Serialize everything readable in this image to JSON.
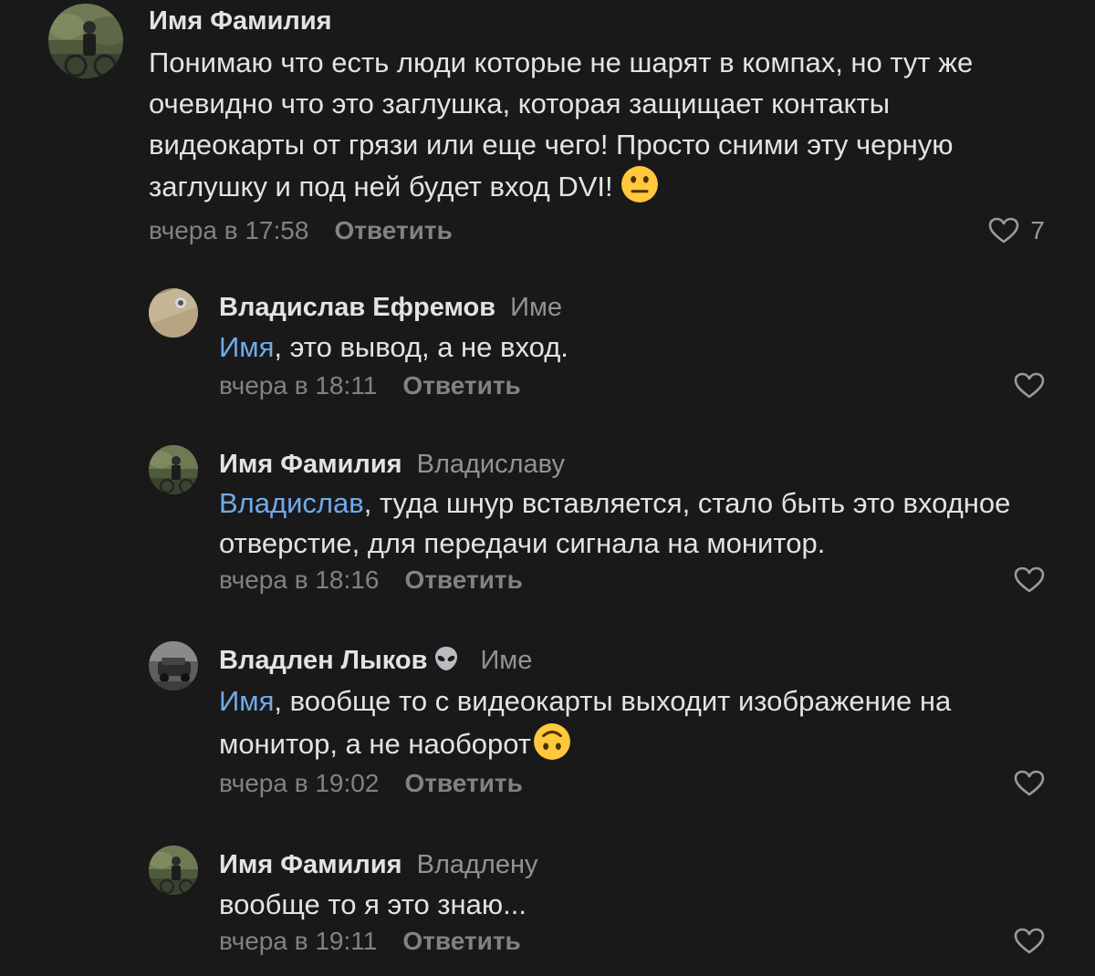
{
  "comments": [
    {
      "author": "Имя Фамилия",
      "reply_to": "",
      "mention": "",
      "text": "Понимаю что есть люди которые не шарят в компах, но тут же очевидно что это заглушка, которая защищает контакты видеокарты от грязи или еще чего! Просто сними эту  черную заглушку и под ней будет вход DVI!",
      "emoji": "neutral-face",
      "time": "вчера в 17:58",
      "reply_label": "Ответить",
      "likes": "7"
    },
    {
      "author": "Владислав Ефремов",
      "reply_to": "Име",
      "mention": "Имя",
      "text": ", это вывод, а не вход.",
      "time": "вчера в 18:11",
      "reply_label": "Ответить"
    },
    {
      "author": "Имя Фамилия",
      "reply_to": "Владиславу",
      "mention": "Владислав",
      "text": ", туда шнур вставляется, стало быть это входное отверстие, для передачи сигнала на монитор.",
      "time": "вчера в 18:16",
      "reply_label": "Ответить"
    },
    {
      "author": "Владлен Лыков",
      "author_emoji": "alien",
      "reply_to": "Име",
      "mention": "Имя",
      "text": ", вообще то с видеокарты выходит изображение на монитор, а не наоборот",
      "emoji": "upside-down-face",
      "time": "вчера в 19:02",
      "reply_label": "Ответить"
    },
    {
      "author": "Имя Фамилия",
      "reply_to": "Владлену",
      "mention": "",
      "text": "вообще то я это знаю...",
      "time": "вчера в 19:11",
      "reply_label": "Ответить"
    }
  ],
  "colors": {
    "background": "#19191a",
    "text": "#e1e3e6",
    "secondary": "#828282",
    "mention": "#71aaeb",
    "emoji_yellow": "#ffc83d"
  }
}
